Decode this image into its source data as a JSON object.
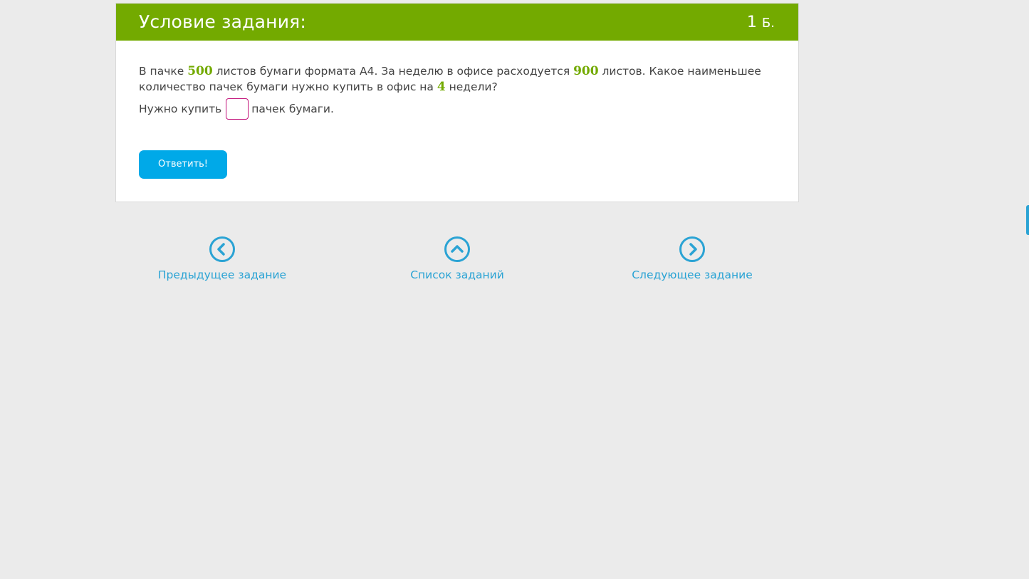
{
  "task": {
    "header_title": "Условие задания:",
    "points_value": "1",
    "points_unit": "Б.",
    "question": {
      "part1": "В пачке ",
      "num1": "500",
      "part2": " листов бумаги формата А4. За неделю в офисе  расходуется ",
      "num2": "900",
      "part3": " листов. Какое наименьшее",
      "part4": "количество пачек бумаги  нужно купить в офис  на ",
      "num3": "4",
      "part5": " недели?"
    },
    "answer": {
      "prefix": "Нужно купить",
      "value": "",
      "suffix": "пачек бумаги."
    },
    "submit_label": "Ответить!"
  },
  "navigation": {
    "prev_label": "Предыдущее задание",
    "list_label": "Список заданий",
    "next_label": "Следующее задание"
  },
  "colors": {
    "header_green": "#73aa00",
    "accent_blue": "#00a9e8",
    "link_blue": "#2aa3d4",
    "input_border": "#c2127a"
  }
}
